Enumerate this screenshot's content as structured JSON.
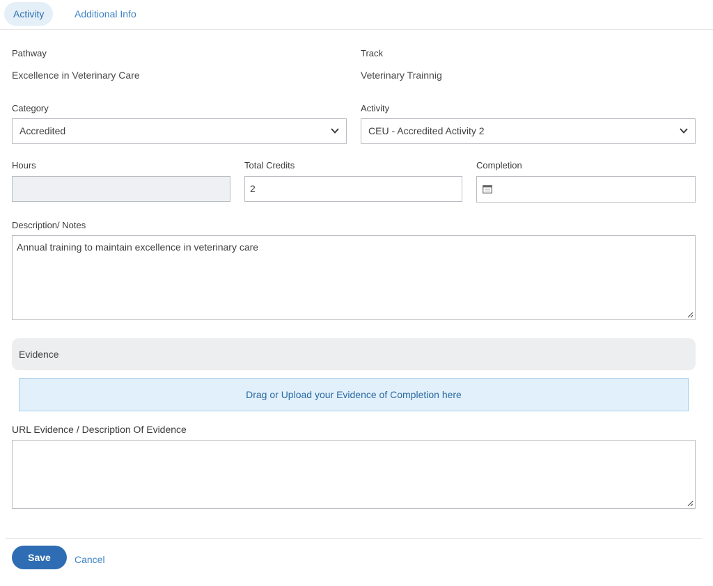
{
  "tabs": {
    "activity": "Activity",
    "additional_info": "Additional Info"
  },
  "form": {
    "pathway": {
      "label": "Pathway",
      "value": "Excellence in Veterinary Care"
    },
    "track": {
      "label": "Track",
      "value": "Veterinary Trainnig"
    },
    "category": {
      "label": "Category",
      "selected": "Accredited"
    },
    "activity": {
      "label": "Activity",
      "selected": "CEU - Accredited Activity 2"
    },
    "hours": {
      "label": "Hours",
      "value": ""
    },
    "total_credits": {
      "label": "Total Credits",
      "value": "2"
    },
    "completion": {
      "label": "Completion",
      "value": ""
    },
    "description": {
      "label": "Description/ Notes",
      "value": "Annual training to maintain excellence in veterinary care"
    }
  },
  "evidence": {
    "heading": "Evidence",
    "dropzone": "Drag or Upload your Evidence of Completion here",
    "url_label": "URL Evidence / Description Of Evidence",
    "url_value": ""
  },
  "actions": {
    "save": "Save",
    "cancel": "Cancel"
  },
  "icons": {
    "chevron": "chevron-down-icon",
    "calendar": "calendar-icon",
    "resize": "resize-grip-icon"
  },
  "colors": {
    "primary": "#2e6db3",
    "link": "#3a82c4",
    "active_tab_bg": "#e4eff8",
    "dropzone_bg": "#e1f0fa"
  }
}
